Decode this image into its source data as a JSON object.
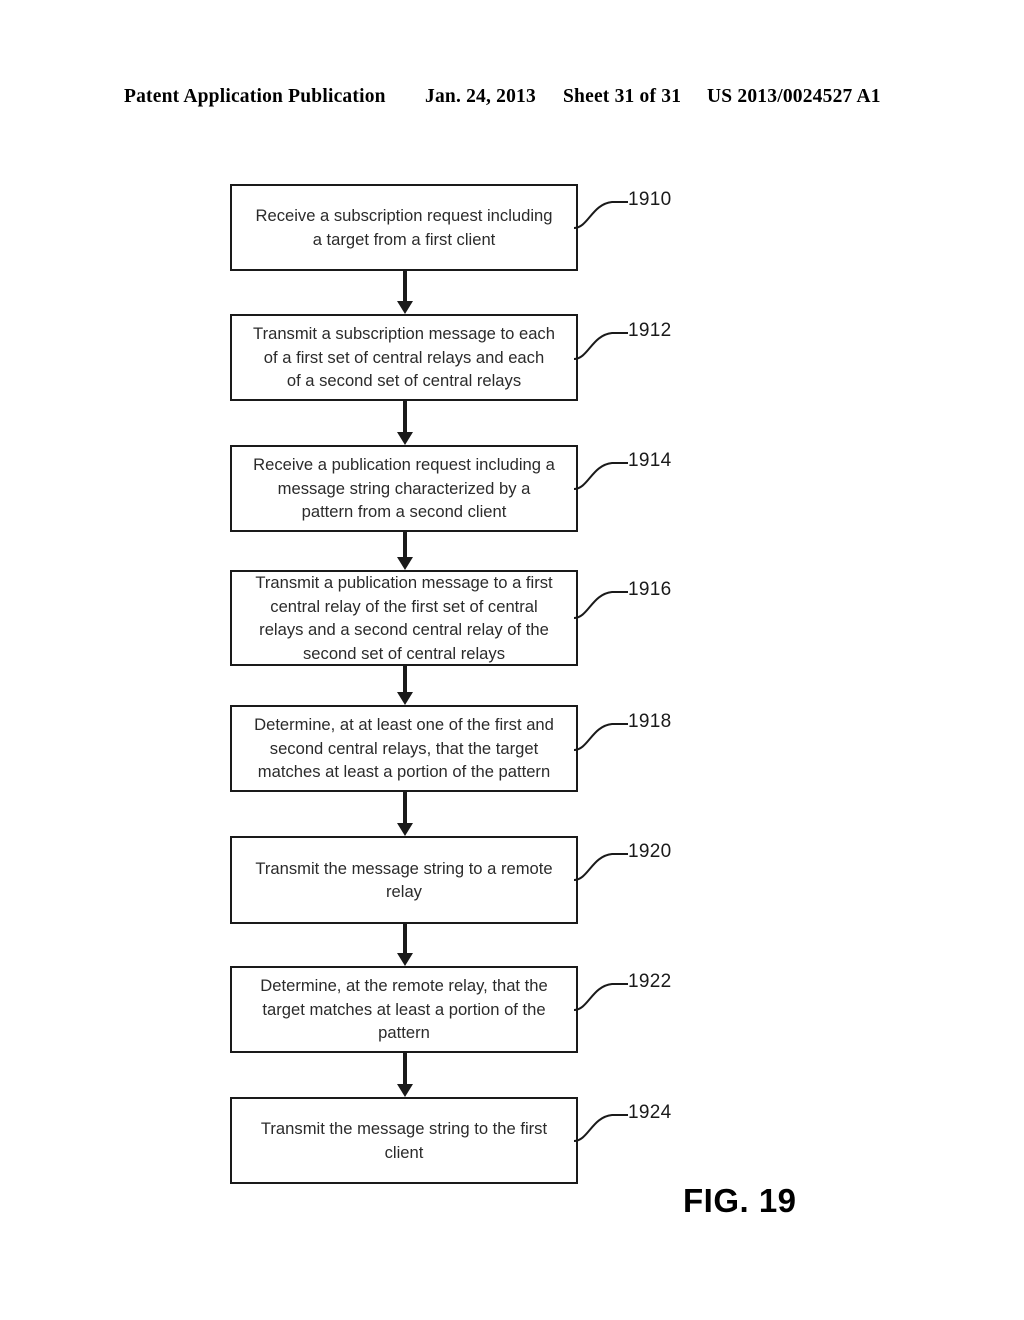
{
  "header": {
    "publication": "Patent Application Publication",
    "date": "Jan. 24, 2013",
    "sheet": "Sheet 31 of 31",
    "patent_number": "US 2013/0024527 A1"
  },
  "figure": {
    "caption": "FIG. 19"
  },
  "flowchart": {
    "steps": [
      {
        "ref": "1910",
        "text": "Receive a subscription request including\na target from a first client"
      },
      {
        "ref": "1912",
        "text": "Transmit a subscription message to each\nof a first set of central relays and each\nof a second set of central relays"
      },
      {
        "ref": "1914",
        "text": "Receive a publication request including a\nmessage string characterized by a\npattern from a second client"
      },
      {
        "ref": "1916",
        "text": "Transmit a publication message to a first\ncentral relay of the first set of central\nrelays and a second central relay of the\nsecond set of central relays"
      },
      {
        "ref": "1918",
        "text": "Determine, at at least one of the first and\nsecond central relays, that the target\nmatches at least a portion of the pattern"
      },
      {
        "ref": "1920",
        "text": "Transmit the message string to a remote\nrelay"
      },
      {
        "ref": "1922",
        "text": "Determine, at the remote relay, that the\ntarget matches at least a portion of the\npattern"
      },
      {
        "ref": "1924",
        "text": "Transmit the message string to the first\nclient"
      }
    ]
  },
  "colors": {
    "stroke": "#1a1a1a",
    "text": "#2b2b2b",
    "background": "#ffffff"
  }
}
